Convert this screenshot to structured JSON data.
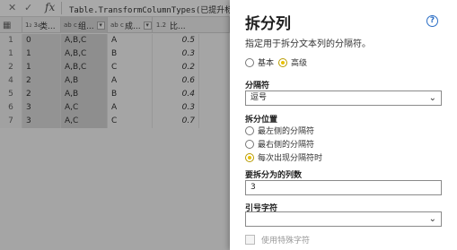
{
  "formula_bar": {
    "formula": "Table.TransformColumnTypes(已提升标题,"
  },
  "grid": {
    "headers": [
      {
        "type_icon": "1₂ 3₄",
        "name": "类..."
      },
      {
        "type_icon": "ab c",
        "name": "组..."
      },
      {
        "type_icon": "ab c",
        "name": "成..."
      },
      {
        "type_icon": "1.2",
        "name": "比..."
      }
    ],
    "rows": [
      {
        "idx": "1",
        "type": "0",
        "group": "A,B,C",
        "result": "A",
        "ratio": "0.5"
      },
      {
        "idx": "1",
        "type": "1",
        "group": "A,B,C",
        "result": "B",
        "ratio": "0.3"
      },
      {
        "idx": "2",
        "type": "1",
        "group": "A,B,C",
        "result": "C",
        "ratio": "0.2"
      },
      {
        "idx": "4",
        "type": "2",
        "group": "A,B",
        "result": "A",
        "ratio": "0.6"
      },
      {
        "idx": "5",
        "type": "2",
        "group": "A,B",
        "result": "B",
        "ratio": "0.4"
      },
      {
        "idx": "6",
        "type": "3",
        "group": "A,C",
        "result": "A",
        "ratio": "0.3"
      },
      {
        "idx": "7",
        "type": "3",
        "group": "A,C",
        "result": "C",
        "ratio": "0.7"
      }
    ]
  },
  "pane": {
    "title": "拆分列",
    "help_icon": "?",
    "subtitle": "指定用于拆分文本列的分隔符。",
    "mode_basic": "基本",
    "mode_advanced": "高级",
    "delimiter_label": "分隔符",
    "delimiter_value": "逗号",
    "split_at_label": "拆分位置",
    "split_leftmost": "最左侧的分隔符",
    "split_rightmost": "最右侧的分隔符",
    "split_each": "每次出现分隔符时",
    "num_columns_label": "要拆分为的列数",
    "num_columns_value": "3",
    "quote_char_label": "引号字符",
    "quote_char_value": "",
    "special_chars_label": "使用特殊字符"
  }
}
